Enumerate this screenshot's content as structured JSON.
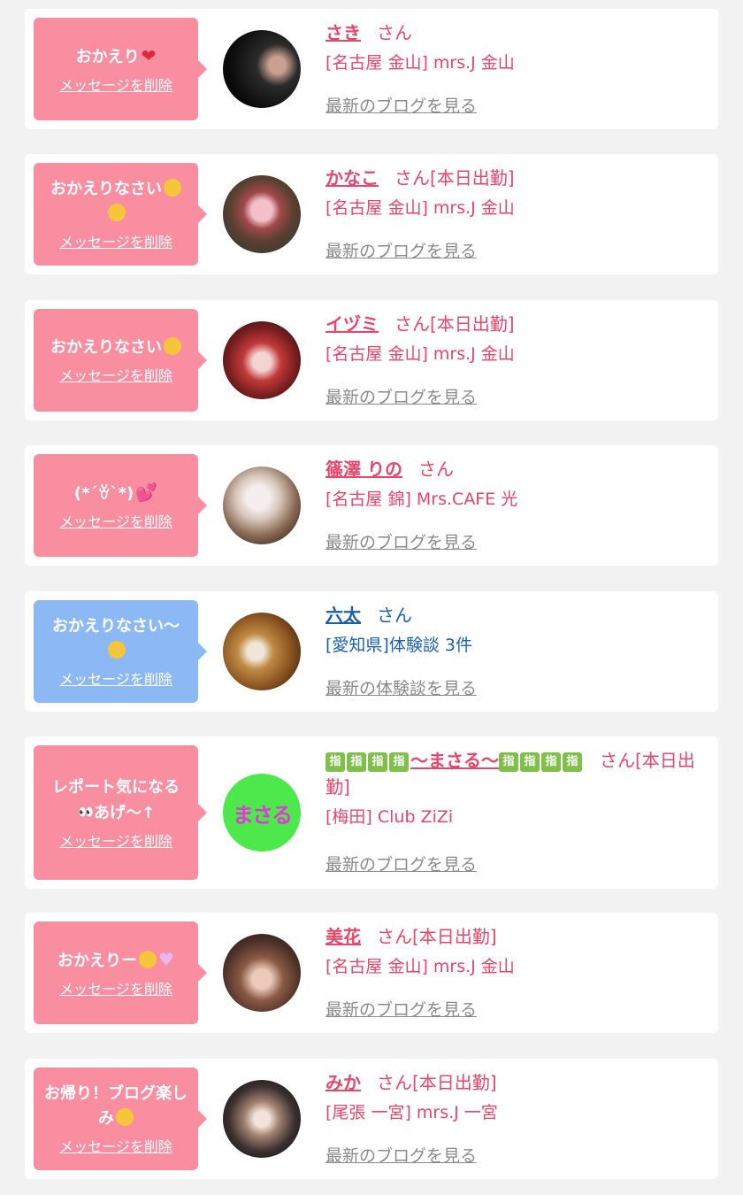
{
  "colors": {
    "pink_bubble": "#f88ea0",
    "blue_bubble": "#8cb9f3",
    "pink_text": "#e5466a",
    "blue_text": "#1c5fae",
    "muted": "#8a8a8a"
  },
  "items": [
    {
      "message": "おかえり",
      "message_emoji": "❤️",
      "delete_label": "メッセージを削除",
      "name": "さき",
      "suffix": "さん",
      "shop": "[名古屋 金山] mrs.J 金山",
      "link": "最新のブログを見る"
    },
    {
      "message": "おかえりなさい",
      "message_emoji": "🤗🤗",
      "delete_label": "メッセージを削除",
      "name": "かなこ",
      "suffix": "さん[本日出勤]",
      "shop": "[名古屋 金山] mrs.J 金山",
      "link": "最新のブログを見る"
    },
    {
      "message": "おかえりなさい",
      "message_emoji": "😊",
      "delete_label": "メッセージを削除",
      "name": "イヅミ",
      "suffix": "さん[本日出勤]",
      "shop": "[名古屋 金山] mrs.J 金山",
      "link": "最新のブログを見る"
    },
    {
      "message": "(*´ꈊ`*)",
      "message_emoji": "💕",
      "delete_label": "メッセージを削除",
      "name": "篠澤 りの",
      "suffix": "さん",
      "shop": "[名古屋 錦] Mrs.CAFE 光",
      "link": "最新のブログを見る"
    },
    {
      "message": "おかえりなさい〜",
      "message_emoji": "🤗",
      "delete_label": "メッセージを削除",
      "name": "六太",
      "suffix": "さん",
      "shop": "[愛知県]体験談 3件",
      "link": "最新の体験談を見る"
    },
    {
      "message": "レポート気になる",
      "message_line2": "あげ〜↑",
      "message_emoji": "👀",
      "delete_label": "メッセージを削除",
      "name_prefix_icon": "指",
      "name": "〜まさる〜",
      "suffix": "さん[本日出勤]",
      "shop": "[梅田] Club ZiZi",
      "link": "最新のブログを見る",
      "avatar_text": "まさる"
    },
    {
      "message": "おかえりー",
      "message_emoji": "😊🤍",
      "delete_label": "メッセージを削除",
      "name": "美花",
      "suffix": "さん[本日出勤]",
      "shop": "[名古屋 金山] mrs.J 金山",
      "link": "最新のブログを見る"
    },
    {
      "message": "お帰り！ブログ楽しみ",
      "message_emoji": "😁",
      "delete_label": "メッセージを削除",
      "name": "みか",
      "suffix": "さん[本日出勤]",
      "shop": "[尾張 一宮] mrs.J 一宮",
      "link": "最新のブログを見る"
    }
  ]
}
